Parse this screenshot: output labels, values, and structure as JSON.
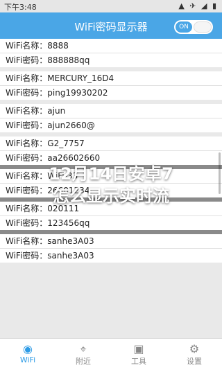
{
  "status": {
    "time": "下午3:48",
    "icons": "▲ ✈ ◢ ▮"
  },
  "app": {
    "title": "WiFi密码显示器",
    "toggle_label": "ON"
  },
  "networks": [
    {
      "name_line": "WiFi名称：8888",
      "pass_line": "WiFi密码：888888qq"
    },
    {
      "name_line": "WiFi名称：MERCURY_16D4",
      "pass_line": "WiFi密码：ping19930202"
    },
    {
      "name_line": "WiFi名称：ajun",
      "pass_line": "WiFi密码：ajun2660@"
    },
    {
      "name_line": "WiFi名称：G2_7757",
      "pass_line": "WiFi密码：aa26602660"
    },
    {
      "name_line": "WiFi名称：WiFi-33",
      "pass_line": "WiFi密码：26601234"
    },
    {
      "name_line": "WiFi名称：020111",
      "pass_line": "WiFi密码：123456qq"
    },
    {
      "name_line": "WiFi名称：sanhe3A03",
      "pass_line": "WiFi密码：sanhe3A03"
    }
  ],
  "overlay": {
    "line1": "12月14日安卓7",
    "line2": "怎么显示实时流"
  },
  "nav": [
    {
      "label": "WiFi",
      "icon": "wifi-icon",
      "glyph": "◉",
      "active": true
    },
    {
      "label": "附近",
      "icon": "location-pin-icon",
      "glyph": "⌖",
      "active": false
    },
    {
      "label": "工具",
      "icon": "toolbox-icon",
      "glyph": "▣",
      "active": false
    },
    {
      "label": "设置",
      "icon": "gear-icon",
      "glyph": "⚙",
      "active": false
    }
  ]
}
